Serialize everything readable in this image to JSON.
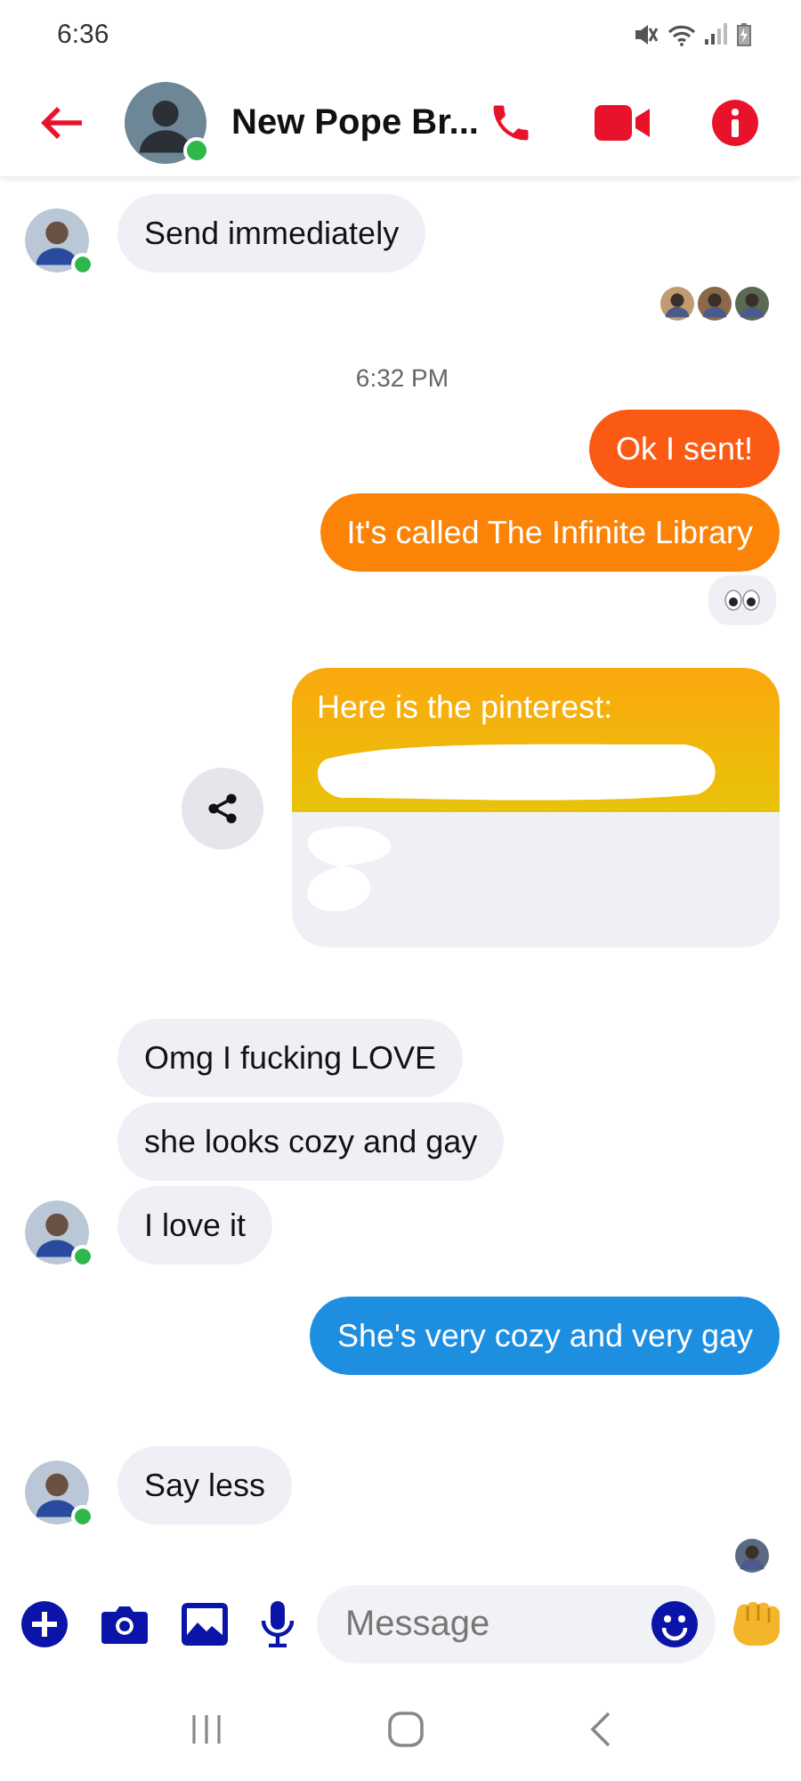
{
  "status_bar": {
    "time": "6:36"
  },
  "header": {
    "title": "New Pope Br...",
    "online": true
  },
  "messages": [
    {
      "kind": "incoming",
      "text": "Send immediately",
      "show_avatar": true
    },
    {
      "kind": "seen",
      "avatars": [
        {
          "color": "#c09a70"
        },
        {
          "color": "#8a6a4a"
        },
        {
          "color": "#5b6a55"
        }
      ]
    },
    {
      "kind": "time",
      "text": "6:32 PM"
    },
    {
      "kind": "outgoing",
      "text": "Ok I sent!",
      "color": "#fa5a14"
    },
    {
      "kind": "outgoing",
      "text": "It's called The Infinite Library",
      "color": "#fb8408"
    },
    {
      "kind": "reaction"
    },
    {
      "kind": "link",
      "text": "Here is the pinterest:"
    },
    {
      "kind": "incoming",
      "text": "Omg I fucking LOVE",
      "show_avatar": false
    },
    {
      "kind": "incoming",
      "text": "she looks cozy and gay",
      "show_avatar": false
    },
    {
      "kind": "incoming",
      "text": "I love it",
      "show_avatar": true
    },
    {
      "kind": "outgoing",
      "text": "She's very cozy and very gay",
      "color": "#1e8fe0"
    },
    {
      "kind": "incoming",
      "text": "Say less",
      "show_avatar": true
    },
    {
      "kind": "seen",
      "avatars": [
        {
          "color": "#5b6a80"
        }
      ]
    }
  ],
  "composer": {
    "placeholder": "Message"
  }
}
